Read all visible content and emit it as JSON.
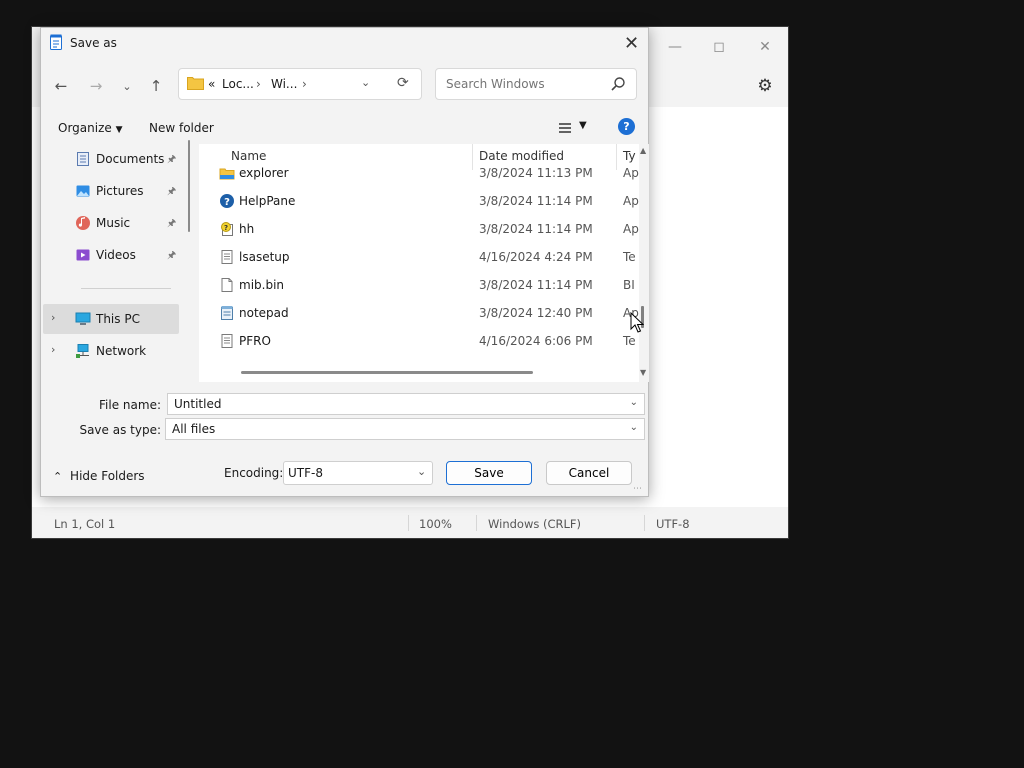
{
  "notepad": {
    "status": {
      "position": "Ln 1, Col 1",
      "zoom": "100%",
      "line_ending": "Windows (CRLF)",
      "encoding": "UTF-8"
    },
    "icons": {
      "minimize": "minimize-icon",
      "maximize": "maximize-icon",
      "close": "close-icon",
      "settings": "gear-icon"
    }
  },
  "dialog": {
    "title": "Save as",
    "address": {
      "overflow": "«",
      "crumbs": [
        "Loc...",
        "Wi..."
      ]
    },
    "search": {
      "placeholder": "Search Windows"
    },
    "toolbar": {
      "organize": "Organize",
      "new_folder": "New folder"
    },
    "nav": [
      {
        "label": "Documents",
        "icon": "documents-icon",
        "pinned": true
      },
      {
        "label": "Pictures",
        "icon": "pictures-icon",
        "pinned": true
      },
      {
        "label": "Music",
        "icon": "music-icon",
        "pinned": true
      },
      {
        "label": "Videos",
        "icon": "videos-icon",
        "pinned": true
      },
      {
        "label": "This PC",
        "icon": "this-pc-icon",
        "selected": true
      },
      {
        "label": "Network",
        "icon": "network-icon"
      }
    ],
    "columns": {
      "name": "Name",
      "date": "Date modified",
      "type": "Ty"
    },
    "files": [
      {
        "name": "explorer",
        "date": "3/8/2024 11:13 PM",
        "type": "Ap",
        "icon": "explorer-icon"
      },
      {
        "name": "HelpPane",
        "date": "3/8/2024 11:14 PM",
        "type": "Ap",
        "icon": "help-pane-icon"
      },
      {
        "name": "hh",
        "date": "3/8/2024 11:14 PM",
        "type": "Ap",
        "icon": "help-file-icon"
      },
      {
        "name": "lsasetup",
        "date": "4/16/2024 4:24 PM",
        "type": "Te",
        "icon": "text-file-icon"
      },
      {
        "name": "mib.bin",
        "date": "3/8/2024 11:14 PM",
        "type": "BI",
        "icon": "file-icon"
      },
      {
        "name": "notepad",
        "date": "3/8/2024 12:40 PM",
        "type": "Ap",
        "icon": "notepad-icon"
      },
      {
        "name": "PFRO",
        "date": "4/16/2024 6:06 PM",
        "type": "Te",
        "icon": "text-file-icon"
      }
    ],
    "file_name": {
      "label": "File name:",
      "value": "Untitled"
    },
    "save_as_type": {
      "label": "Save as type:",
      "value": "All files"
    },
    "hide_folders": "Hide Folders",
    "encoding": {
      "label": "Encoding:",
      "value": "UTF-8"
    },
    "save_label": "Save",
    "cancel_label": "Cancel"
  }
}
